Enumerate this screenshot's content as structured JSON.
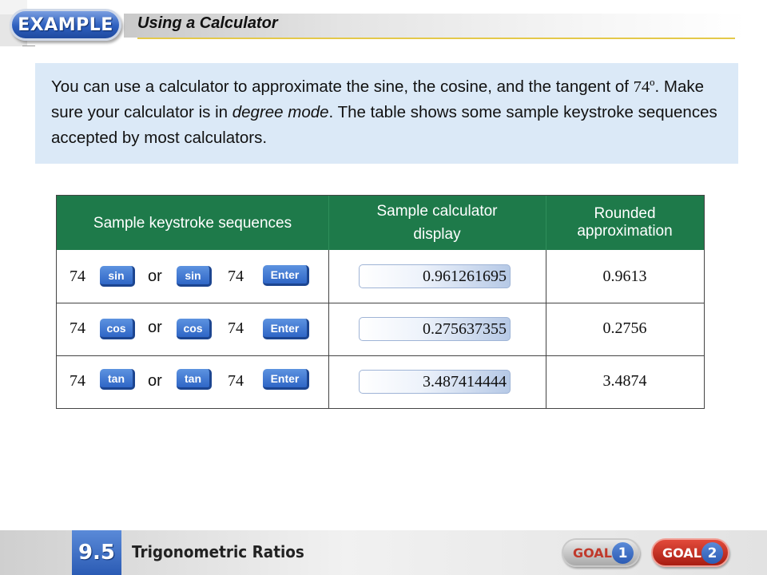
{
  "header": {
    "badge": "EXAMPLE",
    "title": "Using a Calculator"
  },
  "intro": {
    "part1": "You can use a calculator to approximate the sine, the cosine, and the tangent of ",
    "angle": "74º",
    "part2": ". Make sure your calculator is in ",
    "mode": "degree mode",
    "part3": ". The table shows some sample keystroke sequences accepted by most calculators."
  },
  "table": {
    "headers": [
      "Sample keystroke sequences",
      "Sample calculator display",
      "Rounded approximation"
    ],
    "rows": [
      {
        "number": "74",
        "func": "sin",
        "or": "or",
        "enter": "Enter",
        "display": "0.961261695",
        "rounded": "0.9613"
      },
      {
        "number": "74",
        "func": "cos",
        "or": "or",
        "enter": "Enter",
        "display": "0.275637355",
        "rounded": "0.2756"
      },
      {
        "number": "74",
        "func": "tan",
        "or": "or",
        "enter": "Enter",
        "display": "3.487414444",
        "rounded": "3.4874"
      }
    ]
  },
  "footer": {
    "section": "9.5",
    "title": "Trigonometric Ratios",
    "goals": [
      {
        "label": "GOAL",
        "number": "1"
      },
      {
        "label": "GOAL",
        "number": "2"
      }
    ]
  },
  "colors": {
    "table_header": "#1e7a4a",
    "intro_background": "#dbe9f7",
    "key_blue": "#2f66c6",
    "header_rule": "#e4c94a",
    "goal2_red": "#c0392b"
  }
}
